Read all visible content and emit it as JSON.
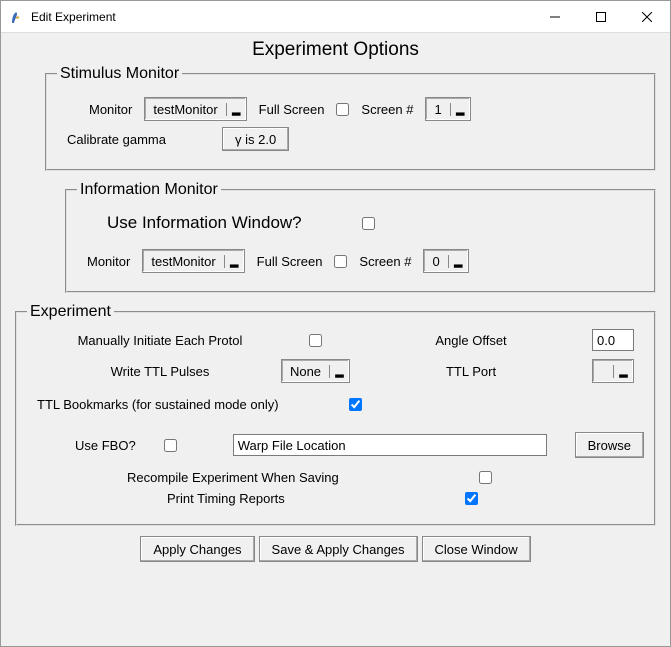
{
  "window": {
    "title": "Edit Experiment"
  },
  "header": "Experiment Options",
  "stimulus": {
    "legend": "Stimulus Monitor",
    "monitor_label": "Monitor",
    "monitor_value": "testMonitor",
    "fullscreen_label": "Full Screen",
    "fullscreen_checked": false,
    "screen_label": "Screen #",
    "screen_value": "1",
    "calibrate_label": "Calibrate gamma",
    "gamma_btn": "γ is 2.0"
  },
  "info": {
    "legend": "Information Monitor",
    "use_label": "Use Information Window?",
    "use_checked": false,
    "monitor_label": "Monitor",
    "monitor_value": "testMonitor",
    "fullscreen_label": "Full Screen",
    "fullscreen_checked": false,
    "screen_label": "Screen #",
    "screen_value": "0"
  },
  "experiment": {
    "legend": "Experiment",
    "manual_label": "Manually Initiate Each Protol",
    "manual_checked": false,
    "angle_label": "Angle Offset",
    "angle_value": "0.0",
    "ttl_write_label": "Write TTL Pulses",
    "ttl_write_value": "None",
    "ttl_port_label": "TTL Port",
    "ttl_port_value": "",
    "bookmarks_label": "TTL Bookmarks (for sustained mode only)",
    "bookmarks_checked": true,
    "fbo_label": "Use FBO?",
    "fbo_checked": false,
    "warp_placeholder": "Warp File Location",
    "warp_value": "Warp File Location",
    "browse_btn": "Browse",
    "recompile_label": "Recompile Experiment When Saving",
    "recompile_checked": false,
    "timing_label": "Print Timing Reports",
    "timing_checked": true
  },
  "buttons": {
    "apply": "Apply Changes",
    "save_apply": "Save & Apply Changes",
    "close": "Close Window"
  }
}
